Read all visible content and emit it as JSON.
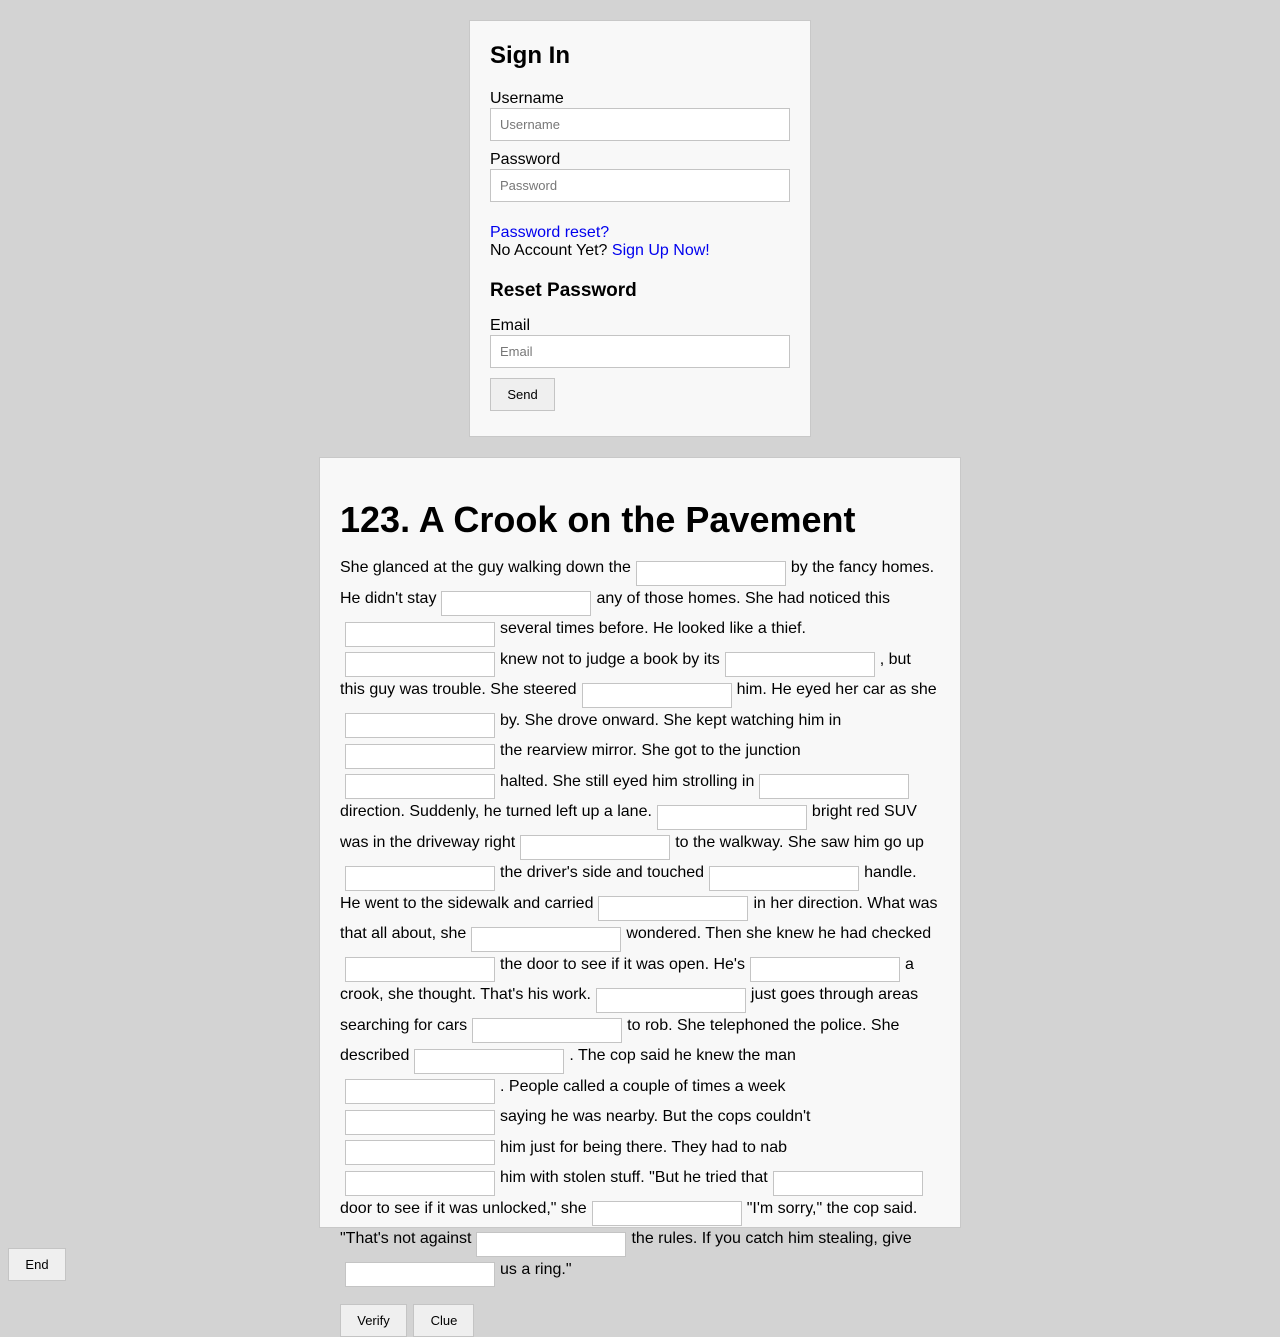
{
  "signin": {
    "title": "Sign In",
    "username_label": "Username",
    "username_placeholder": "Username",
    "password_label": "Password",
    "password_placeholder": "Password",
    "reset_link": "Password reset?",
    "no_account_text": "No Account Yet?",
    "signup_link": "Sign Up Now!",
    "reset_title": "Reset Password",
    "email_label": "Email",
    "email_placeholder": "Email",
    "send_label": "Send"
  },
  "story": {
    "title": "123. A Crook on the Pavement",
    "segments": [
      "She glanced at the guy walking down the",
      "by the fancy homes. He didn't stay",
      "any of those homes. She had noticed this",
      "several times before. He looked like a thief.",
      "knew not to judge a book by its",
      ", but this guy was trouble. She steered",
      "him. He eyed her car as she",
      "by. She drove onward. She kept watching him in",
      "the rearview mirror. She got to the junction",
      "halted. She still eyed him strolling in",
      "direction. Suddenly, he turned left up a lane.",
      "bright red SUV was in the driveway right",
      "to the walkway. She saw him go up",
      "the driver's side and touched",
      "handle. He went to the sidewalk and carried",
      "in her direction. What was that all about, she",
      "wondered. Then she knew he had checked",
      "the door to see if it was open. He's",
      "a crook, she thought. That's his work.",
      "just goes through areas searching for cars",
      "to rob. She telephoned the police. She described",
      ". The cop said he knew the man",
      ". People called a couple of times a week",
      "saying he was nearby. But the cops couldn't",
      "him just for being there. They had to nab",
      "him with stolen stuff. \"But he tried that",
      "door to see if it was unlocked,\" she",
      "\"I'm sorry,\" the cop said. \"That's not against",
      "the rules. If you catch him stealing, give",
      "us a ring.\""
    ],
    "verify_label": "Verify",
    "clue_label": "Clue"
  },
  "footer": {
    "end_label": "End"
  }
}
